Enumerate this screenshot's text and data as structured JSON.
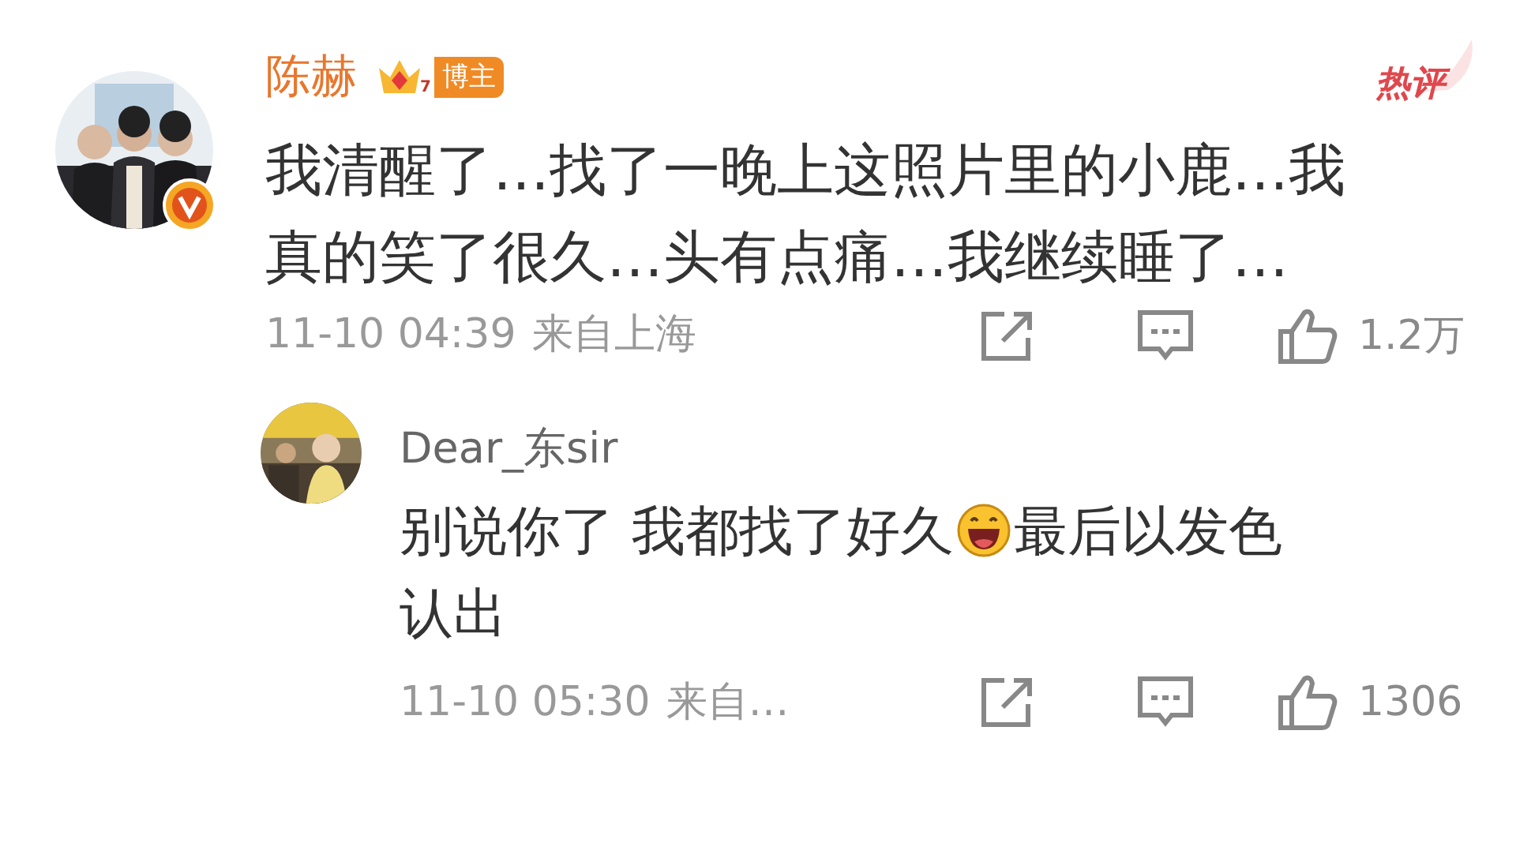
{
  "comment": {
    "author": "陈赫",
    "badge": {
      "level": "7",
      "label": "博主"
    },
    "tag": "热评",
    "body_lines": [
      "我清醒了…找了一晚上这照片里的小鹿…我",
      "真的笑了很久…头有点痛…我继续睡了…"
    ],
    "time": "11-10 04:39",
    "source": "来自上海",
    "likes": "1.2万"
  },
  "reply": {
    "author": "Dear_东sir",
    "body_lines": [
      [
        "别说你了 我都找了好久",
        "最后以发色"
      ],
      [
        "认出"
      ]
    ],
    "time": "11-10 05:30",
    "source": "来自…",
    "likes": "1306"
  }
}
